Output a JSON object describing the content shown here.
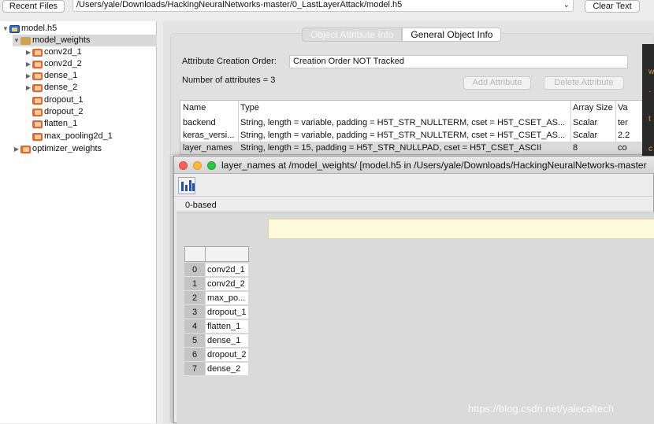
{
  "toolbar": {
    "recent_files": "Recent Files",
    "path": "/Users/yale/Downloads/HackingNeuralNetworks-master/0_LastLayerAttack/model.h5",
    "clear_text": "Clear Text"
  },
  "tree": {
    "root": "model.h5",
    "group": "model_weights",
    "children": [
      "conv2d_1",
      "conv2d_2",
      "dense_1",
      "dense_2",
      "dropout_1",
      "dropout_2",
      "flatten_1",
      "max_pooling2d_1"
    ],
    "sibling": "optimizer_weights"
  },
  "tabs": {
    "object_attr": "Object Attribute Info",
    "general": "General Object Info"
  },
  "attributes": {
    "creation_order_label": "Attribute Creation Order:",
    "creation_order_value": "Creation Order NOT Tracked",
    "count_label": "Number of attributes = 3",
    "add_button": "Add Attribute",
    "delete_button": "Delete Attribute",
    "columns": [
      "Name",
      "Type",
      "Array Size",
      "Va"
    ],
    "rows": [
      [
        "backend",
        "String, length = variable, padding = H5T_STR_NULLTERM, cset = H5T_CSET_AS...",
        "Scalar",
        "ter"
      ],
      [
        "keras_versi...",
        "String, length = variable, padding = H5T_STR_NULLTERM, cset = H5T_CSET_AS...",
        "Scalar",
        "2.2"
      ],
      [
        "layer_names",
        "String, length = 15, padding = H5T_STR_NULLPAD, cset = H5T_CSET_ASCII",
        "8",
        "co"
      ]
    ]
  },
  "dataset_window": {
    "title": "layer_names  at  /model_weights/  [model.h5  in  /Users/yale/Downloads/HackingNeuralNetworks-master",
    "index_base": "0-based",
    "rows": [
      {
        "index": "0",
        "value": "conv2d_1"
      },
      {
        "index": "1",
        "value": "conv2d_2"
      },
      {
        "index": "2",
        "value": "max_po..."
      },
      {
        "index": "3",
        "value": "dropout_1"
      },
      {
        "index": "4",
        "value": "flatten_1"
      },
      {
        "index": "5",
        "value": "dense_1"
      },
      {
        "index": "6",
        "value": "dropout_2"
      },
      {
        "index": "7",
        "value": "dense_2"
      }
    ]
  },
  "watermark": "https://blog.csdn.net/yalecaltech",
  "icons": {
    "root": "hdf-file-icon",
    "group": "open-folder-icon",
    "dataset": "dataset-icon",
    "chart": "chart-icon"
  },
  "colors": {
    "selection": "#d9d9d9",
    "dataset_icon": "#e5662a",
    "yellow_field": "#fffadc"
  }
}
